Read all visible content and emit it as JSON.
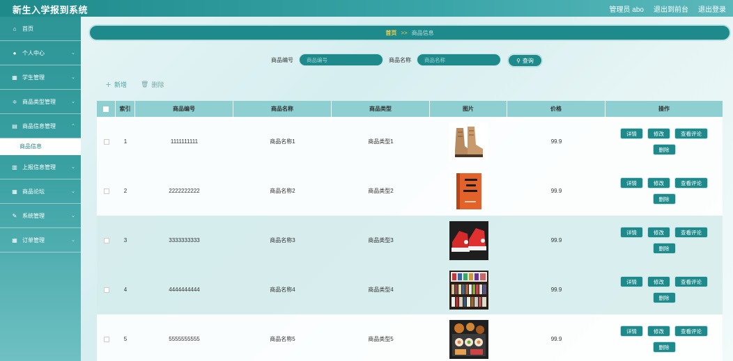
{
  "app": {
    "title": "新生入学报到系统"
  },
  "topbar": {
    "admin": "管理员 abo",
    "back": "退出到前台",
    "logout": "退出登录"
  },
  "sidebar": {
    "items": [
      {
        "label": "首页",
        "icon": "home-icon"
      },
      {
        "label": "个人中心",
        "icon": "user-icon"
      },
      {
        "label": "学生管理",
        "icon": "grid-icon"
      },
      {
        "label": "商品类型管理",
        "icon": "sliders-icon"
      },
      {
        "label": "商品信息管理",
        "icon": "doc-icon"
      },
      {
        "label": "上报信息管理",
        "icon": "clipboard-icon"
      },
      {
        "label": "商品论坛",
        "icon": "grid-icon"
      },
      {
        "label": "系统管理",
        "icon": "tools-icon"
      },
      {
        "label": "订单管理",
        "icon": "grid-icon"
      }
    ],
    "active_sub": "商品信息"
  },
  "breadcrumb": {
    "home": "首页",
    "sep": ">>",
    "current": "商品信息"
  },
  "search": {
    "code_label": "商品编号",
    "code_placeholder": "商品编号",
    "name_label": "商品名称",
    "name_placeholder": "商品名称",
    "button": "查询"
  },
  "actions": {
    "add": "新增",
    "delete": "删除"
  },
  "table": {
    "headers": {
      "index": "索引",
      "code": "商品编号",
      "name": "商品名称",
      "type": "商品类型",
      "image": "图片",
      "price": "价格",
      "ops": "操作"
    },
    "rows": [
      {
        "index": "1",
        "code": "1111111111",
        "name": "商品名称1",
        "type": "商品类型1",
        "price": "99.9"
      },
      {
        "index": "2",
        "code": "2222222222",
        "name": "商品名称2",
        "type": "商品类型2",
        "price": "99.9"
      },
      {
        "index": "3",
        "code": "3333333333",
        "name": "商品名称3",
        "type": "商品类型3",
        "price": "99.9"
      },
      {
        "index": "4",
        "code": "4444444444",
        "name": "商品名称4",
        "type": "商品类型4",
        "price": "99.9"
      },
      {
        "index": "5",
        "code": "5555555555",
        "name": "商品名称5",
        "type": "商品类型5",
        "price": "99.9"
      }
    ],
    "buttons": {
      "detail": "详情",
      "edit": "修改",
      "reviews": "查看评论",
      "delete": "删除"
    }
  },
  "colors": {
    "primary": "#1f8a8b",
    "accent": "#f5d04c",
    "header_bg": "#8ecfd1"
  }
}
